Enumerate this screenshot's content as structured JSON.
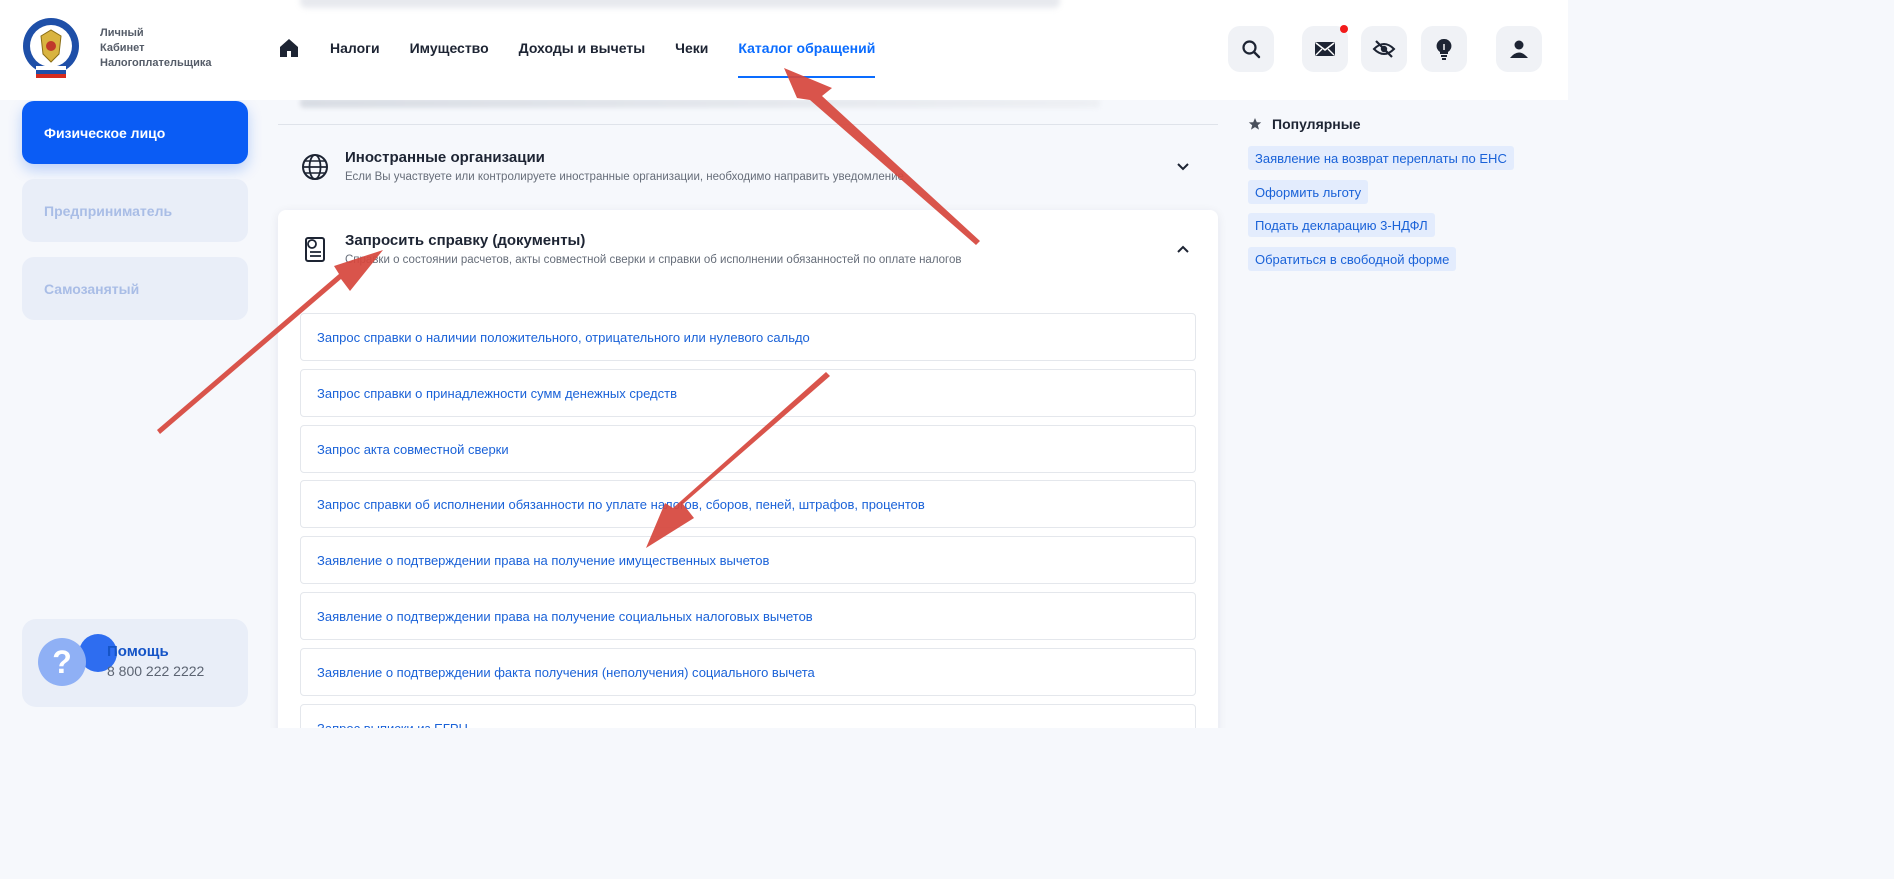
{
  "app": {
    "logo_lines": [
      "Личный",
      "Кабинет",
      "Налогоплательщика"
    ]
  },
  "nav": {
    "items": [
      {
        "label": "Налоги"
      },
      {
        "label": "Имущество"
      },
      {
        "label": "Доходы и вычеты"
      },
      {
        "label": "Чеки"
      },
      {
        "label": "Каталог обращений",
        "active": true
      }
    ]
  },
  "header_icons": [
    "search-icon",
    "mail-icon",
    "eye-off-icon",
    "lightbulb-icon",
    "user-icon"
  ],
  "sidebar": {
    "items": [
      {
        "label": "Физическое лицо",
        "active": true
      },
      {
        "label": "Предприниматель"
      },
      {
        "label": "Самозанятый"
      }
    ],
    "help": {
      "title": "Помощь",
      "phone": "8 800 222 2222"
    }
  },
  "main": {
    "sections": [
      {
        "title": "Иностранные организации",
        "subtitle": "Если Вы участвуете или контролируете иностранные организации, необходимо направить уведомление",
        "expanded": false
      },
      {
        "title": "Запросить справку (документы)",
        "subtitle": "Справки о состоянии расчетов, акты совместной сверки и справки об исполнении обязанностей по оплате налогов",
        "expanded": true,
        "items": [
          "Запрос справки о наличии положительного, отрицательного или нулевого сальдо",
          "Запрос справки о принадлежности сумм денежных средств",
          "Запрос акта совместной сверки",
          "Запрос справки об исполнении обязанности по уплате налогов, сборов, пеней, штрафов, процентов",
          "Заявление о подтверждении права на получение имущественных вычетов",
          "Заявление о подтверждении права на получение социальных налоговых вычетов",
          "Заявление о подтверждении факта получения (неполучения) социального вычета",
          "Запрос выписки из ЕГРН"
        ]
      }
    ]
  },
  "popular": {
    "title": "Популярные",
    "links": [
      "Заявление на возврат переплаты по ЕНС",
      "Оформить льготу",
      "Подать декларацию 3-НДФЛ",
      "Обратиться в свободной форме"
    ]
  },
  "colors": {
    "accent": "#0a6cff",
    "sidebar_active": "#0a5cf5",
    "link": "#1a62d8",
    "annotation_arrow": "#d6473d",
    "notification": "#f21b1b"
  }
}
